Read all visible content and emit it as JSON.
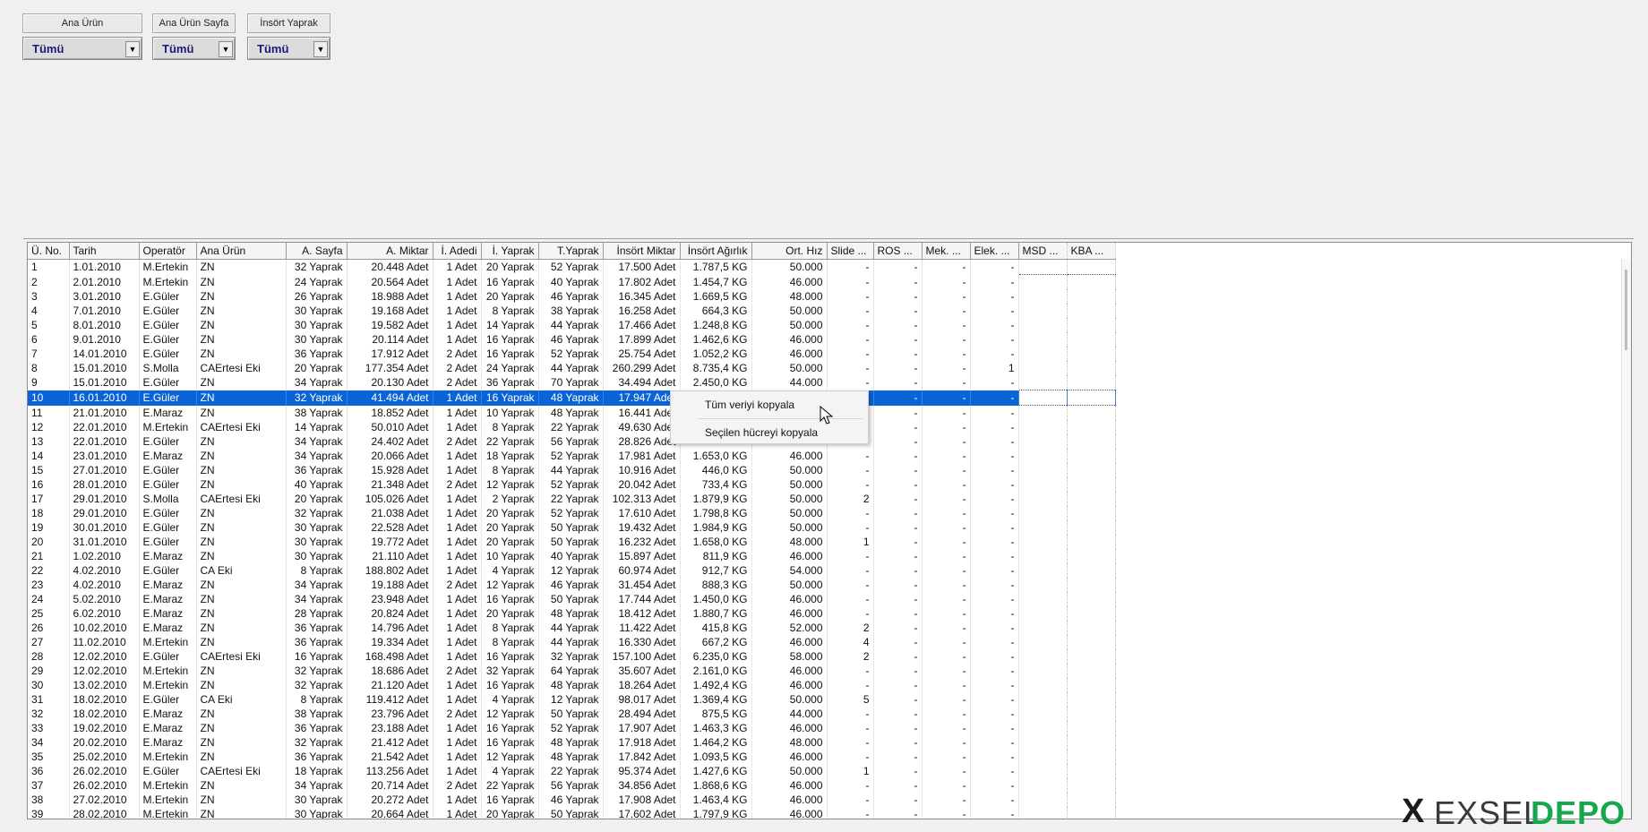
{
  "filters": [
    {
      "label": "Ana Ürün",
      "value": "Tümü"
    },
    {
      "label": "Ana Ürün Sayfa",
      "value": "Tümü"
    },
    {
      "label": "İnsört Yaprak",
      "value": "Tümü"
    }
  ],
  "grid": {
    "columns": [
      "Ü. No.",
      "Tarih",
      "Operatör",
      "Ana Ürün",
      "A. Sayfa",
      "A. Miktar",
      "İ. Adedi",
      "İ. Yaprak",
      "T.Yaprak",
      "İnsört Miktar",
      "İnsört Ağırlık",
      "Ort. Hız",
      "Slide ...",
      "ROS ...",
      "Mek. ...",
      "Elek. ...",
      "MSD ...",
      "KBA ..."
    ],
    "selected_row": 10,
    "rows": [
      [
        "1",
        "1.01.2010",
        "M.Ertekin",
        "ZN",
        "32 Yaprak",
        "20.448 Adet",
        "1 Adet",
        "20 Yaprak",
        "52 Yaprak",
        "17.500 Adet",
        "1.787,5 KG",
        "50.000",
        "-",
        "-",
        "-",
        "-",
        "",
        ""
      ],
      [
        "2",
        "2.01.2010",
        "M.Ertekin",
        "ZN",
        "24 Yaprak",
        "20.564 Adet",
        "1 Adet",
        "16 Yaprak",
        "40 Yaprak",
        "17.802 Adet",
        "1.454,7 KG",
        "46.000",
        "-",
        "-",
        "-",
        "-",
        "",
        ""
      ],
      [
        "3",
        "3.01.2010",
        "E.Güler",
        "ZN",
        "26 Yaprak",
        "18.988 Adet",
        "1 Adet",
        "20 Yaprak",
        "46 Yaprak",
        "16.345 Adet",
        "1.669,5 KG",
        "48.000",
        "-",
        "-",
        "-",
        "-",
        "",
        ""
      ],
      [
        "4",
        "7.01.2010",
        "E.Güler",
        "ZN",
        "30 Yaprak",
        "19.168 Adet",
        "1 Adet",
        "8 Yaprak",
        "38 Yaprak",
        "16.258 Adet",
        "664,3 KG",
        "50.000",
        "-",
        "-",
        "-",
        "-",
        "",
        ""
      ],
      [
        "5",
        "8.01.2010",
        "E.Güler",
        "ZN",
        "30 Yaprak",
        "19.582 Adet",
        "1 Adet",
        "14 Yaprak",
        "44 Yaprak",
        "17.466 Adet",
        "1.248,8 KG",
        "50.000",
        "-",
        "-",
        "-",
        "-",
        "",
        ""
      ],
      [
        "6",
        "9.01.2010",
        "E.Güler",
        "ZN",
        "30 Yaprak",
        "20.114 Adet",
        "1 Adet",
        "16 Yaprak",
        "46 Yaprak",
        "17.899 Adet",
        "1.462,6 KG",
        "46.000",
        "-",
        "-",
        "-",
        "-",
        "",
        ""
      ],
      [
        "7",
        "14.01.2010",
        "E.Güler",
        "ZN",
        "36 Yaprak",
        "17.912 Adet",
        "2 Adet",
        "16 Yaprak",
        "52 Yaprak",
        "25.754 Adet",
        "1.052,2 KG",
        "46.000",
        "-",
        "-",
        "-",
        "-",
        "",
        ""
      ],
      [
        "8",
        "15.01.2010",
        "S.Molla",
        "CAErtesi Eki",
        "20 Yaprak",
        "177.354 Adet",
        "2 Adet",
        "24 Yaprak",
        "44 Yaprak",
        "260.299 Adet",
        "8.735,4 KG",
        "50.000",
        "-",
        "-",
        "-",
        "1",
        "",
        ""
      ],
      [
        "9",
        "15.01.2010",
        "E.Güler",
        "ZN",
        "34 Yaprak",
        "20.130 Adet",
        "2 Adet",
        "36 Yaprak",
        "70 Yaprak",
        "34.494 Adet",
        "2.450,0 KG",
        "44.000",
        "-",
        "-",
        "-",
        "-",
        "",
        ""
      ],
      [
        "10",
        "16.01.2010",
        "E.Güler",
        "ZN",
        "32 Yaprak",
        "41.494 Adet",
        "1 Adet",
        "16 Yaprak",
        "48 Yaprak",
        "17.947 Adet",
        "",
        "",
        "",
        "-",
        "-",
        "-",
        "",
        ""
      ],
      [
        "11",
        "21.01.2010",
        "E.Maraz",
        "ZN",
        "38 Yaprak",
        "18.852 Adet",
        "1 Adet",
        "10 Yaprak",
        "48 Yaprak",
        "16.441 Adet",
        "",
        "",
        "",
        "-",
        "-",
        "-",
        "",
        ""
      ],
      [
        "12",
        "22.01.2010",
        "M.Ertekin",
        "CAErtesi Eki",
        "14 Yaprak",
        "50.010 Adet",
        "1 Adet",
        "8 Yaprak",
        "22 Yaprak",
        "49.630 Adet",
        "",
        "",
        "",
        "-",
        "-",
        "-",
        "",
        ""
      ],
      [
        "13",
        "22.01.2010",
        "E.Güler",
        "ZN",
        "34 Yaprak",
        "24.402 Adet",
        "2 Adet",
        "22 Yaprak",
        "56 Yaprak",
        "28.826 Adet",
        "",
        "",
        "",
        "-",
        "-",
        "-",
        "",
        ""
      ],
      [
        "14",
        "23.01.2010",
        "E.Maraz",
        "ZN",
        "34 Yaprak",
        "20.066 Adet",
        "1 Adet",
        "18 Yaprak",
        "52 Yaprak",
        "17.981 Adet",
        "1.653,0 KG",
        "46.000",
        "-",
        "-",
        "-",
        "-",
        "",
        ""
      ],
      [
        "15",
        "27.01.2010",
        "E.Güler",
        "ZN",
        "36 Yaprak",
        "15.928 Adet",
        "1 Adet",
        "8 Yaprak",
        "44 Yaprak",
        "10.916 Adet",
        "446,0 KG",
        "50.000",
        "-",
        "-",
        "-",
        "-",
        "",
        ""
      ],
      [
        "16",
        "28.01.2010",
        "E.Güler",
        "ZN",
        "40 Yaprak",
        "21.348 Adet",
        "2 Adet",
        "12 Yaprak",
        "52 Yaprak",
        "20.042 Adet",
        "733,4 KG",
        "50.000",
        "-",
        "-",
        "-",
        "-",
        "",
        ""
      ],
      [
        "17",
        "29.01.2010",
        "S.Molla",
        "CAErtesi Eki",
        "20 Yaprak",
        "105.026 Adet",
        "1 Adet",
        "2 Yaprak",
        "22 Yaprak",
        "102.313 Adet",
        "1.879,9 KG",
        "50.000",
        "2",
        "-",
        "-",
        "-",
        "",
        ""
      ],
      [
        "18",
        "29.01.2010",
        "E.Güler",
        "ZN",
        "32 Yaprak",
        "21.038 Adet",
        "1 Adet",
        "20 Yaprak",
        "52 Yaprak",
        "17.610 Adet",
        "1.798,8 KG",
        "50.000",
        "-",
        "-",
        "-",
        "-",
        "",
        ""
      ],
      [
        "19",
        "30.01.2010",
        "E.Güler",
        "ZN",
        "30 Yaprak",
        "22.528 Adet",
        "1 Adet",
        "20 Yaprak",
        "50 Yaprak",
        "19.432 Adet",
        "1.984,9 KG",
        "50.000",
        "-",
        "-",
        "-",
        "-",
        "",
        ""
      ],
      [
        "20",
        "31.01.2010",
        "E.Güler",
        "ZN",
        "30 Yaprak",
        "19.772 Adet",
        "1 Adet",
        "20 Yaprak",
        "50 Yaprak",
        "16.232 Adet",
        "1.658,0 KG",
        "48.000",
        "1",
        "-",
        "-",
        "-",
        "",
        ""
      ],
      [
        "21",
        "1.02.2010",
        "E.Maraz",
        "ZN",
        "30 Yaprak",
        "21.110 Adet",
        "1 Adet",
        "10 Yaprak",
        "40 Yaprak",
        "15.897 Adet",
        "811,9 KG",
        "46.000",
        "-",
        "-",
        "-",
        "-",
        "",
        ""
      ],
      [
        "22",
        "4.02.2010",
        "E.Güler",
        "CA Eki",
        "8 Yaprak",
        "188.802 Adet",
        "1 Adet",
        "4 Yaprak",
        "12 Yaprak",
        "60.974 Adet",
        "912,7 KG",
        "54.000",
        "-",
        "-",
        "-",
        "-",
        "",
        ""
      ],
      [
        "23",
        "4.02.2010",
        "E.Maraz",
        "ZN",
        "34 Yaprak",
        "19.188 Adet",
        "2 Adet",
        "12 Yaprak",
        "46 Yaprak",
        "31.454 Adet",
        "888,3 KG",
        "50.000",
        "-",
        "-",
        "-",
        "-",
        "",
        ""
      ],
      [
        "24",
        "5.02.2010",
        "E.Maraz",
        "ZN",
        "34 Yaprak",
        "23.948 Adet",
        "1 Adet",
        "16 Yaprak",
        "50 Yaprak",
        "17.744 Adet",
        "1.450,0 KG",
        "46.000",
        "-",
        "-",
        "-",
        "-",
        "",
        ""
      ],
      [
        "25",
        "6.02.2010",
        "E.Maraz",
        "ZN",
        "28 Yaprak",
        "20.824 Adet",
        "1 Adet",
        "20 Yaprak",
        "48 Yaprak",
        "18.412 Adet",
        "1.880,7 KG",
        "46.000",
        "-",
        "-",
        "-",
        "-",
        "",
        ""
      ],
      [
        "26",
        "10.02.2010",
        "E.Maraz",
        "ZN",
        "36 Yaprak",
        "14.796 Adet",
        "1 Adet",
        "8 Yaprak",
        "44 Yaprak",
        "11.422 Adet",
        "415,8 KG",
        "52.000",
        "2",
        "-",
        "-",
        "-",
        "",
        ""
      ],
      [
        "27",
        "11.02.2010",
        "M.Ertekin",
        "ZN",
        "36 Yaprak",
        "19.334 Adet",
        "1 Adet",
        "8 Yaprak",
        "44 Yaprak",
        "16.330 Adet",
        "667,2 KG",
        "46.000",
        "4",
        "-",
        "-",
        "-",
        "",
        ""
      ],
      [
        "28",
        "12.02.2010",
        "E.Güler",
        "CAErtesi Eki",
        "16 Yaprak",
        "168.498 Adet",
        "1 Adet",
        "16 Yaprak",
        "32 Yaprak",
        "157.100 Adet",
        "6.235,0 KG",
        "58.000",
        "2",
        "-",
        "-",
        "-",
        "",
        ""
      ],
      [
        "29",
        "12.02.2010",
        "M.Ertekin",
        "ZN",
        "32 Yaprak",
        "18.686 Adet",
        "2 Adet",
        "32 Yaprak",
        "64 Yaprak",
        "35.607 Adet",
        "2.161,0 KG",
        "46.000",
        "-",
        "-",
        "-",
        "-",
        "",
        ""
      ],
      [
        "30",
        "13.02.2010",
        "M.Ertekin",
        "ZN",
        "32 Yaprak",
        "21.120 Adet",
        "1 Adet",
        "16 Yaprak",
        "48 Yaprak",
        "18.264 Adet",
        "1.492,4 KG",
        "46.000",
        "-",
        "-",
        "-",
        "-",
        "",
        ""
      ],
      [
        "31",
        "18.02.2010",
        "E.Güler",
        "CA Eki",
        "8 Yaprak",
        "119.412 Adet",
        "1 Adet",
        "4 Yaprak",
        "12 Yaprak",
        "98.017 Adet",
        "1.369,4 KG",
        "50.000",
        "5",
        "-",
        "-",
        "-",
        "",
        ""
      ],
      [
        "32",
        "18.02.2010",
        "E.Maraz",
        "ZN",
        "38 Yaprak",
        "23.796 Adet",
        "2 Adet",
        "12 Yaprak",
        "50 Yaprak",
        "28.494 Adet",
        "875,5 KG",
        "44.000",
        "-",
        "-",
        "-",
        "-",
        "",
        ""
      ],
      [
        "33",
        "19.02.2010",
        "E.Maraz",
        "ZN",
        "36 Yaprak",
        "23.188 Adet",
        "1 Adet",
        "16 Yaprak",
        "52 Yaprak",
        "17.907 Adet",
        "1.463,3 KG",
        "46.000",
        "-",
        "-",
        "-",
        "-",
        "",
        ""
      ],
      [
        "34",
        "20.02.2010",
        "E.Maraz",
        "ZN",
        "32 Yaprak",
        "21.412 Adet",
        "1 Adet",
        "16 Yaprak",
        "48 Yaprak",
        "17.918 Adet",
        "1.464,2 KG",
        "48.000",
        "-",
        "-",
        "-",
        "-",
        "",
        ""
      ],
      [
        "35",
        "25.02.2010",
        "M.Ertekin",
        "ZN",
        "36 Yaprak",
        "21.542 Adet",
        "1 Adet",
        "12 Yaprak",
        "48 Yaprak",
        "17.842 Adet",
        "1.093,5 KG",
        "46.000",
        "-",
        "-",
        "-",
        "-",
        "",
        ""
      ],
      [
        "36",
        "26.02.2010",
        "E.Güler",
        "CAErtesi Eki",
        "18 Yaprak",
        "113.256 Adet",
        "1 Adet",
        "4 Yaprak",
        "22 Yaprak",
        "95.374 Adet",
        "1.427,6 KG",
        "50.000",
        "1",
        "-",
        "-",
        "-",
        "",
        ""
      ],
      [
        "37",
        "26.02.2010",
        "M.Ertekin",
        "ZN",
        "34 Yaprak",
        "20.714 Adet",
        "2 Adet",
        "22 Yaprak",
        "56 Yaprak",
        "34.856 Adet",
        "1.868,6 KG",
        "46.000",
        "-",
        "-",
        "-",
        "-",
        "",
        ""
      ],
      [
        "38",
        "27.02.2010",
        "M.Ertekin",
        "ZN",
        "30 Yaprak",
        "20.272 Adet",
        "1 Adet",
        "16 Yaprak",
        "46 Yaprak",
        "17.908 Adet",
        "1.463,4 KG",
        "46.000",
        "-",
        "-",
        "-",
        "-",
        "",
        ""
      ],
      [
        "39",
        "28.02.2010",
        "M.Ertekin",
        "ZN",
        "30 Yaprak",
        "20.664 Adet",
        "1 Adet",
        "20 Yaprak",
        "50 Yaprak",
        "17.602 Adet",
        "1.797,9 KG",
        "46.000",
        "-",
        "-",
        "-",
        "-",
        "",
        ""
      ]
    ]
  },
  "context_menu": {
    "items": [
      "Tüm veriyi kopyala",
      "Seçilen hücreyi kopyala"
    ]
  },
  "watermark": {
    "prefix": "X",
    "text_dark": "EXSEL",
    "text_green": "DEPO"
  }
}
